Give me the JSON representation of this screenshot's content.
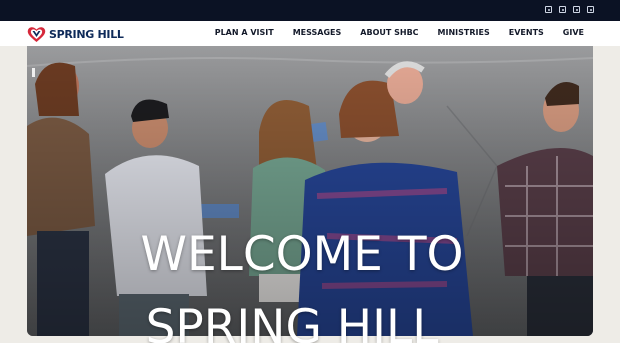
{
  "topbar": {
    "social_icons": [
      "facebook-icon",
      "instagram-icon",
      "youtube-icon",
      "podcast-icon"
    ],
    "background": "#0b1224"
  },
  "header": {
    "logo_text": "SPRING HILL",
    "brand_colors": {
      "navy": "#0e2a59",
      "red": "#d6283a"
    }
  },
  "nav": {
    "items": [
      {
        "label": "PLAN A VISIT"
      },
      {
        "label": "MESSAGES"
      },
      {
        "label": "ABOUT SHBC"
      },
      {
        "label": "MINISTRIES"
      },
      {
        "label": "EVENTS"
      },
      {
        "label": "GIVE"
      }
    ]
  },
  "hero": {
    "line1": "WELCOME TO",
    "line2": "SPRING HILL"
  }
}
